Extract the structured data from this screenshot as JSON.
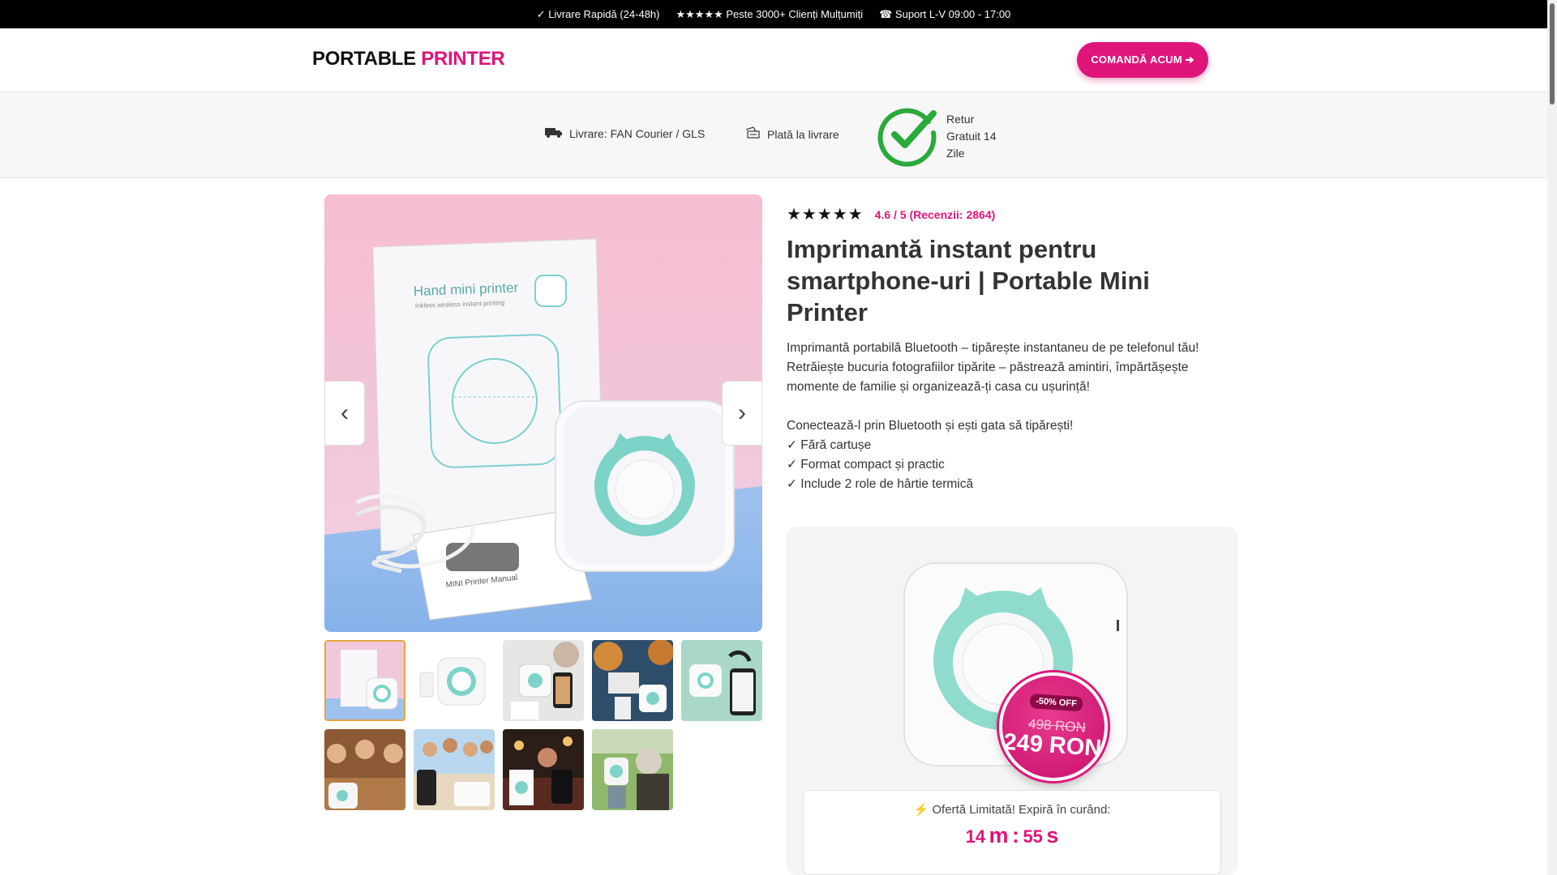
{
  "topbar": {
    "delivery": "✓ Livrare Rapidă (24-48h)",
    "clients": "★★★★★ Peste 3000+ Clienți Mulțumiți",
    "support": "☎ Suport L-V 09:00 - 17:00"
  },
  "header": {
    "logo_part1": "PORTABLE",
    "logo_part2": "PRINTER",
    "cta_label": "COMANDĂ ACUM ➔"
  },
  "trust": {
    "shipping": "Livrare: FAN Courier / GLS",
    "payment": "Plată la livrare",
    "returns": "Retur Gratuit 14 Zile"
  },
  "gallery": {
    "prev_label": "‹",
    "next_label": "›",
    "thumbs": [
      "box-and-printer",
      "printer-white",
      "printer-with-photos",
      "printer-outdoor",
      "printer-phone-stickers",
      "family-table",
      "party-phone",
      "christmas-table",
      "outdoor-couple"
    ]
  },
  "product": {
    "stars": "★★★★★",
    "rating_text": "4.6 / 5 (Recenzii: 2864)",
    "title": "Imprimantă instant pentru smartphone-uri | Portable Mini Printer",
    "desc_line1": "Imprimantă portabilă Bluetooth – tipărește instantaneu de pe telefonul tău! Retrăiește bucuria fotografiilor tipărite – păstrează amintiri, împărtășește momente de familie și organizează-ți casa cu ușurință!",
    "desc_line2": "Conectează-l prin Bluetooth și ești gata să tipărești!",
    "bullet1": "✓ Fără cartușe",
    "bullet2": "✓ Format compact și practic",
    "bullet3": "✓ Include 2 role de hârtie termică"
  },
  "offer": {
    "discount": "-50% OFF",
    "old_price": "498 RON",
    "new_price": "249 RON",
    "timer_label": "⚡ Ofertă Limitată! Expiră în curând:",
    "minutes": "14",
    "minutes_unit": "m",
    "separator": ":",
    "seconds": "55",
    "seconds_unit": "s"
  },
  "colors": {
    "accent": "#e0157a",
    "topbar": "#000000",
    "check_green": "#2aaa3a"
  }
}
